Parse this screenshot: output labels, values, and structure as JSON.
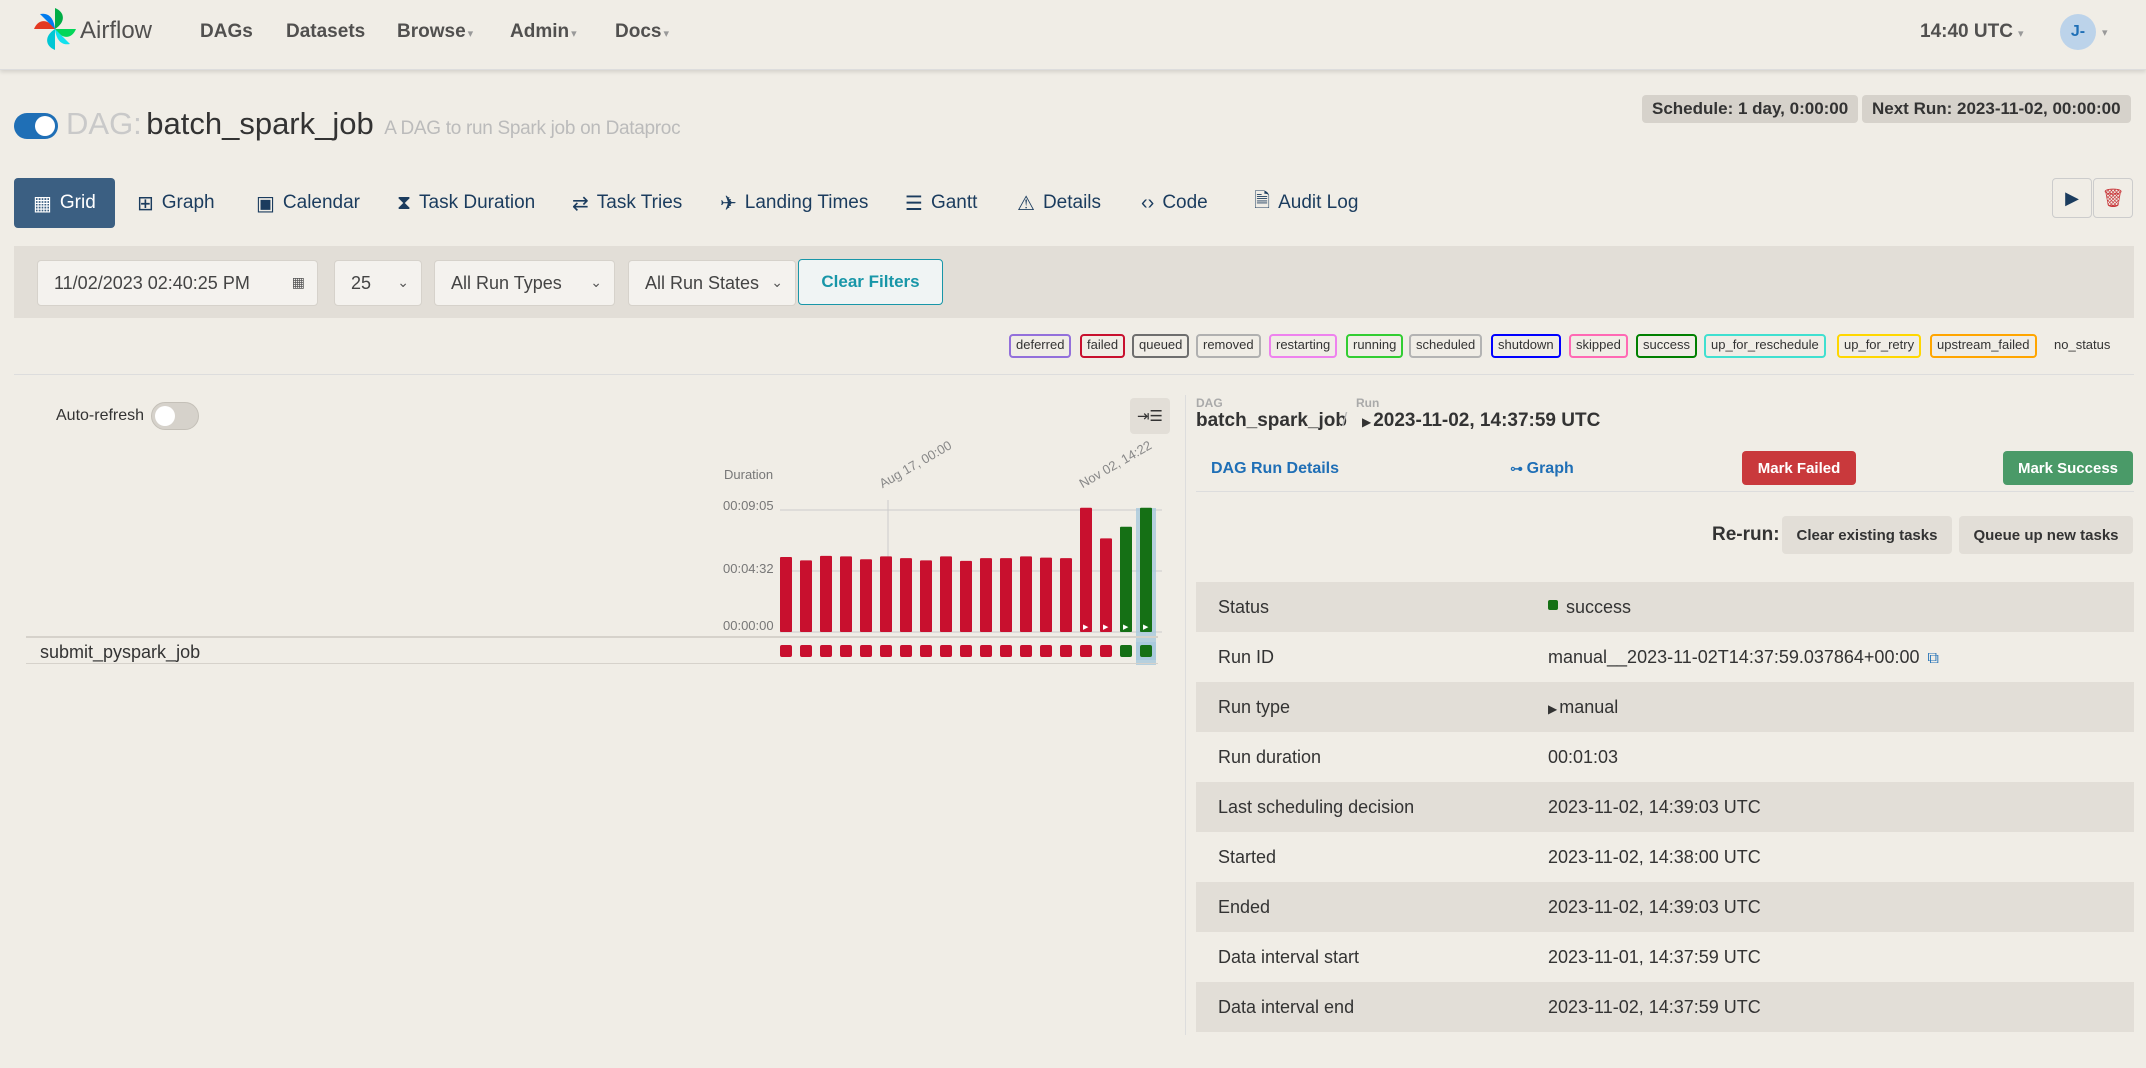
{
  "app": {
    "brand": "Airflow",
    "nav": [
      "DAGs",
      "Datasets",
      "Browse",
      "Admin",
      "Docs"
    ],
    "time": "14:40 UTC",
    "user_initials": "J-"
  },
  "dag": {
    "prefix": "DAG:",
    "name": "batch_spark_job",
    "description": "A DAG to run Spark job on Dataproc",
    "schedule": "Schedule: 1 day, 0:00:00",
    "next_run": "Next Run: 2023-11-02, 00:00:00"
  },
  "tabs": [
    "Grid",
    "Graph",
    "Calendar",
    "Task Duration",
    "Task Tries",
    "Landing Times",
    "Gantt",
    "Details",
    "Code",
    "Audit Log"
  ],
  "filters": {
    "date": "11/02/2023 02:40:25 PM",
    "limit": "25",
    "run_types": "All Run Types",
    "run_states": "All Run States",
    "clear": "Clear Filters"
  },
  "legend": [
    {
      "label": "deferred",
      "color": "#9370db"
    },
    {
      "label": "failed",
      "color": "#c8102e"
    },
    {
      "label": "queued",
      "color": "#6e6e6e"
    },
    {
      "label": "removed",
      "color": "#b0b0b0"
    },
    {
      "label": "restarting",
      "color": "#ee82ee"
    },
    {
      "label": "running",
      "color": "#32cd32"
    },
    {
      "label": "scheduled",
      "color": "#b3b3b3"
    },
    {
      "label": "shutdown",
      "color": "#0000ff"
    },
    {
      "label": "skipped",
      "color": "#ff69b4"
    },
    {
      "label": "success",
      "color": "#008000"
    },
    {
      "label": "up_for_reschedule",
      "color": "#40e0d0"
    },
    {
      "label": "up_for_retry",
      "color": "#ffd700"
    },
    {
      "label": "upstream_failed",
      "color": "#ffa500"
    },
    {
      "label": "no_status",
      "color": ""
    }
  ],
  "grid": {
    "auto_refresh": "Auto-refresh",
    "duration_label": "Duration",
    "y_ticks": [
      "00:09:05",
      "00:04:32",
      "00:00:00"
    ],
    "x_dates": [
      "Aug 17, 00:00",
      "Nov 02, 14:22"
    ],
    "task": "submit_pyspark_job"
  },
  "chart_data": {
    "type": "bar",
    "ylabel": "Duration",
    "ylim_seconds": [
      0,
      545
    ],
    "values_seconds": [
      335,
      320,
      340,
      338,
      325,
      338,
      330,
      320,
      338,
      318,
      330,
      330,
      338,
      332,
      330,
      555,
      418,
      470,
      555
    ],
    "states": [
      "failed",
      "failed",
      "failed",
      "failed",
      "failed",
      "failed",
      "failed",
      "failed",
      "failed",
      "failed",
      "failed",
      "failed",
      "failed",
      "failed",
      "failed",
      "failed",
      "failed",
      "success",
      "success"
    ],
    "selected_index": 18
  },
  "run": {
    "dag_label": "DAG",
    "dag_name": "batch_spark_job",
    "run_label": "Run",
    "run_name": "2023-11-02, 14:37:59 UTC",
    "tab_details": "DAG Run Details",
    "tab_graph": "Graph",
    "mark_failed": "Mark Failed",
    "mark_success": "Mark Success",
    "rerun_label": "Re-run:",
    "clear_tasks": "Clear existing tasks",
    "queue_tasks": "Queue up new tasks",
    "rows": [
      {
        "label": "Status",
        "value": "success"
      },
      {
        "label": "Run ID",
        "value": "manual__2023-11-02T14:37:59.037864+00:00"
      },
      {
        "label": "Run type",
        "value": "manual"
      },
      {
        "label": "Run duration",
        "value": "00:01:03"
      },
      {
        "label": "Last scheduling decision",
        "value": "2023-11-02, 14:39:03 UTC"
      },
      {
        "label": "Started",
        "value": "2023-11-02, 14:38:00 UTC"
      },
      {
        "label": "Ended",
        "value": "2023-11-02, 14:39:03 UTC"
      },
      {
        "label": "Data interval start",
        "value": "2023-11-01, 14:37:59 UTC"
      },
      {
        "label": "Data interval end",
        "value": "2023-11-02, 14:37:59 UTC"
      }
    ]
  }
}
